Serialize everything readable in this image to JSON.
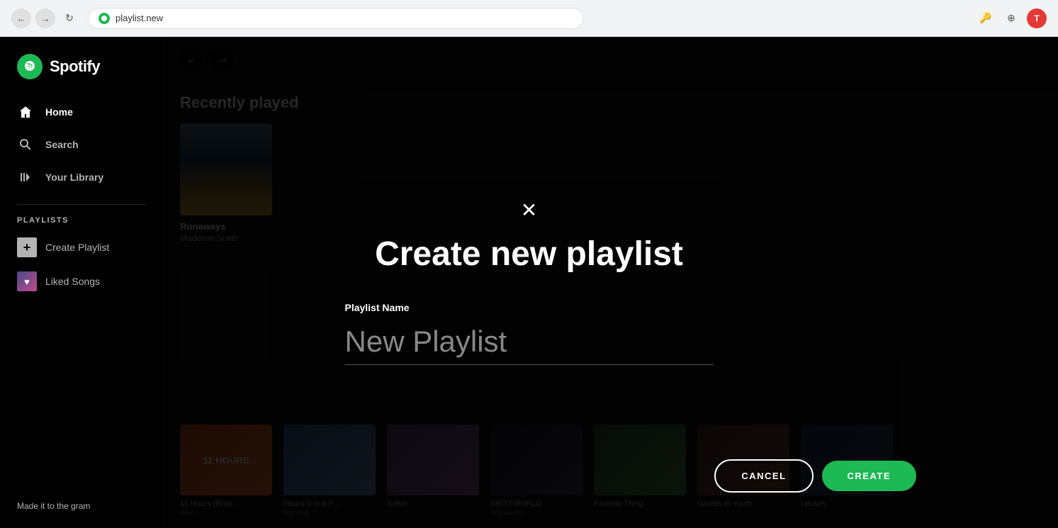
{
  "browser": {
    "url": "playlist.new",
    "back_disabled": false,
    "forward_disabled": false
  },
  "sidebar": {
    "logo": "Spotify",
    "nav": {
      "home_label": "Home",
      "search_label": "Search",
      "library_label": "Your Library"
    },
    "playlists_section": "PLAYLISTS",
    "create_playlist_label": "Create Playlist",
    "liked_songs_label": "Liked Songs"
  },
  "footer": {
    "text": "Made it to the gram"
  },
  "main": {
    "recently_played_title": "Recently played",
    "albums": [
      {
        "title": "Runaways",
        "artist": "Madeline Smith"
      }
    ]
  },
  "bottom_row": {
    "cards": [
      {
        "title": "11 Hours (Bran...",
        "sub": "Aloe...",
        "type": "11hours"
      },
      {
        "title": "Heard It In A P...",
        "sub": "Hip-Hop...",
        "type": "heardit"
      },
      {
        "title": "Sober",
        "sub": "",
        "type": "sober"
      },
      {
        "title": "WESTWORLD",
        "sub": "Television...",
        "type": "westworld"
      },
      {
        "title": "Favorite Thing",
        "sub": "",
        "type": "favthing"
      },
      {
        "title": "Ghosts of Youth",
        "sub": "",
        "type": "ghosts"
      },
      {
        "title": "Lenses",
        "sub": "",
        "type": "lenses"
      }
    ]
  },
  "modal": {
    "title": "Create new playlist",
    "close_icon": "✕",
    "form_label": "Playlist Name",
    "form_placeholder": "New Playlist",
    "cancel_label": "CANCEL",
    "create_label": "CREATE"
  }
}
